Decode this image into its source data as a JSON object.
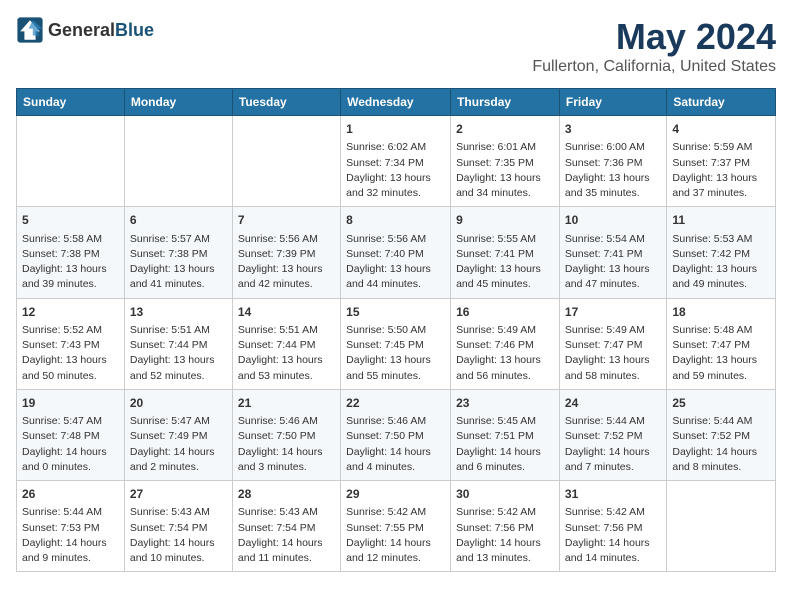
{
  "header": {
    "logo_general": "General",
    "logo_blue": "Blue",
    "month": "May 2024",
    "location": "Fullerton, California, United States"
  },
  "days_of_week": [
    "Sunday",
    "Monday",
    "Tuesday",
    "Wednesday",
    "Thursday",
    "Friday",
    "Saturday"
  ],
  "weeks": [
    [
      {
        "day": "",
        "content": ""
      },
      {
        "day": "",
        "content": ""
      },
      {
        "day": "",
        "content": ""
      },
      {
        "day": "1",
        "content": "Sunrise: 6:02 AM\nSunset: 7:34 PM\nDaylight: 13 hours\nand 32 minutes."
      },
      {
        "day": "2",
        "content": "Sunrise: 6:01 AM\nSunset: 7:35 PM\nDaylight: 13 hours\nand 34 minutes."
      },
      {
        "day": "3",
        "content": "Sunrise: 6:00 AM\nSunset: 7:36 PM\nDaylight: 13 hours\nand 35 minutes."
      },
      {
        "day": "4",
        "content": "Sunrise: 5:59 AM\nSunset: 7:37 PM\nDaylight: 13 hours\nand 37 minutes."
      }
    ],
    [
      {
        "day": "5",
        "content": "Sunrise: 5:58 AM\nSunset: 7:38 PM\nDaylight: 13 hours\nand 39 minutes."
      },
      {
        "day": "6",
        "content": "Sunrise: 5:57 AM\nSunset: 7:38 PM\nDaylight: 13 hours\nand 41 minutes."
      },
      {
        "day": "7",
        "content": "Sunrise: 5:56 AM\nSunset: 7:39 PM\nDaylight: 13 hours\nand 42 minutes."
      },
      {
        "day": "8",
        "content": "Sunrise: 5:56 AM\nSunset: 7:40 PM\nDaylight: 13 hours\nand 44 minutes."
      },
      {
        "day": "9",
        "content": "Sunrise: 5:55 AM\nSunset: 7:41 PM\nDaylight: 13 hours\nand 45 minutes."
      },
      {
        "day": "10",
        "content": "Sunrise: 5:54 AM\nSunset: 7:41 PM\nDaylight: 13 hours\nand 47 minutes."
      },
      {
        "day": "11",
        "content": "Sunrise: 5:53 AM\nSunset: 7:42 PM\nDaylight: 13 hours\nand 49 minutes."
      }
    ],
    [
      {
        "day": "12",
        "content": "Sunrise: 5:52 AM\nSunset: 7:43 PM\nDaylight: 13 hours\nand 50 minutes."
      },
      {
        "day": "13",
        "content": "Sunrise: 5:51 AM\nSunset: 7:44 PM\nDaylight: 13 hours\nand 52 minutes."
      },
      {
        "day": "14",
        "content": "Sunrise: 5:51 AM\nSunset: 7:44 PM\nDaylight: 13 hours\nand 53 minutes."
      },
      {
        "day": "15",
        "content": "Sunrise: 5:50 AM\nSunset: 7:45 PM\nDaylight: 13 hours\nand 55 minutes."
      },
      {
        "day": "16",
        "content": "Sunrise: 5:49 AM\nSunset: 7:46 PM\nDaylight: 13 hours\nand 56 minutes."
      },
      {
        "day": "17",
        "content": "Sunrise: 5:49 AM\nSunset: 7:47 PM\nDaylight: 13 hours\nand 58 minutes."
      },
      {
        "day": "18",
        "content": "Sunrise: 5:48 AM\nSunset: 7:47 PM\nDaylight: 13 hours\nand 59 minutes."
      }
    ],
    [
      {
        "day": "19",
        "content": "Sunrise: 5:47 AM\nSunset: 7:48 PM\nDaylight: 14 hours\nand 0 minutes."
      },
      {
        "day": "20",
        "content": "Sunrise: 5:47 AM\nSunset: 7:49 PM\nDaylight: 14 hours\nand 2 minutes."
      },
      {
        "day": "21",
        "content": "Sunrise: 5:46 AM\nSunset: 7:50 PM\nDaylight: 14 hours\nand 3 minutes."
      },
      {
        "day": "22",
        "content": "Sunrise: 5:46 AM\nSunset: 7:50 PM\nDaylight: 14 hours\nand 4 minutes."
      },
      {
        "day": "23",
        "content": "Sunrise: 5:45 AM\nSunset: 7:51 PM\nDaylight: 14 hours\nand 6 minutes."
      },
      {
        "day": "24",
        "content": "Sunrise: 5:44 AM\nSunset: 7:52 PM\nDaylight: 14 hours\nand 7 minutes."
      },
      {
        "day": "25",
        "content": "Sunrise: 5:44 AM\nSunset: 7:52 PM\nDaylight: 14 hours\nand 8 minutes."
      }
    ],
    [
      {
        "day": "26",
        "content": "Sunrise: 5:44 AM\nSunset: 7:53 PM\nDaylight: 14 hours\nand 9 minutes."
      },
      {
        "day": "27",
        "content": "Sunrise: 5:43 AM\nSunset: 7:54 PM\nDaylight: 14 hours\nand 10 minutes."
      },
      {
        "day": "28",
        "content": "Sunrise: 5:43 AM\nSunset: 7:54 PM\nDaylight: 14 hours\nand 11 minutes."
      },
      {
        "day": "29",
        "content": "Sunrise: 5:42 AM\nSunset: 7:55 PM\nDaylight: 14 hours\nand 12 minutes."
      },
      {
        "day": "30",
        "content": "Sunrise: 5:42 AM\nSunset: 7:56 PM\nDaylight: 14 hours\nand 13 minutes."
      },
      {
        "day": "31",
        "content": "Sunrise: 5:42 AM\nSunset: 7:56 PM\nDaylight: 14 hours\nand 14 minutes."
      },
      {
        "day": "",
        "content": ""
      }
    ]
  ]
}
